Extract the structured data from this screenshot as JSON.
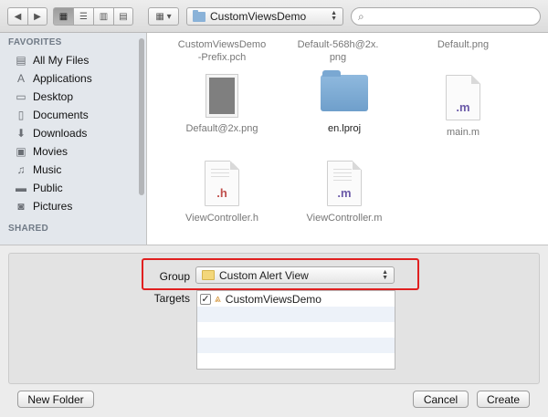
{
  "toolbar": {
    "back_icon": "chevron-left-icon",
    "forward_icon": "chevron-right-icon",
    "view_modes": [
      "icon-view",
      "list-view",
      "column-view",
      "coverflow-view"
    ],
    "arrange_icon": "arrange-grid-icon",
    "location": "CustomViewsDemo",
    "search_placeholder": ""
  },
  "sidebar": {
    "favorites_heading": "FAVORITES",
    "items": [
      {
        "label": "All My Files",
        "icon": "all-files-icon"
      },
      {
        "label": "Applications",
        "icon": "applications-icon"
      },
      {
        "label": "Desktop",
        "icon": "desktop-icon"
      },
      {
        "label": "Documents",
        "icon": "documents-icon"
      },
      {
        "label": "Downloads",
        "icon": "downloads-icon"
      },
      {
        "label": "Movies",
        "icon": "movies-icon"
      },
      {
        "label": "Music",
        "icon": "music-icon"
      },
      {
        "label": "Public",
        "icon": "public-folder-icon"
      },
      {
        "label": "Pictures",
        "icon": "pictures-icon"
      }
    ],
    "shared_heading": "SHARED"
  },
  "files": [
    {
      "name": "CustomViewsDemo\n-Prefix.pch",
      "type": "pch"
    },
    {
      "name": "Default-568h@2x.\npng",
      "type": "png"
    },
    {
      "name": "Default.png",
      "type": "png"
    },
    {
      "name": "Default@2x.png",
      "type": "png"
    },
    {
      "name": "en.lproj",
      "type": "folder"
    },
    {
      "name": "main.m",
      "type": "m"
    },
    {
      "name": "ViewController.h",
      "type": "h"
    },
    {
      "name": "ViewController.m",
      "type": "m"
    }
  ],
  "options": {
    "group_label": "Group",
    "group_value": "Custom Alert View",
    "targets_label": "Targets",
    "targets": [
      {
        "name": "CustomViewsDemo",
        "checked": true
      }
    ],
    "highlight_color": "#e02020"
  },
  "buttons": {
    "new_folder": "New Folder",
    "cancel": "Cancel",
    "create": "Create"
  }
}
